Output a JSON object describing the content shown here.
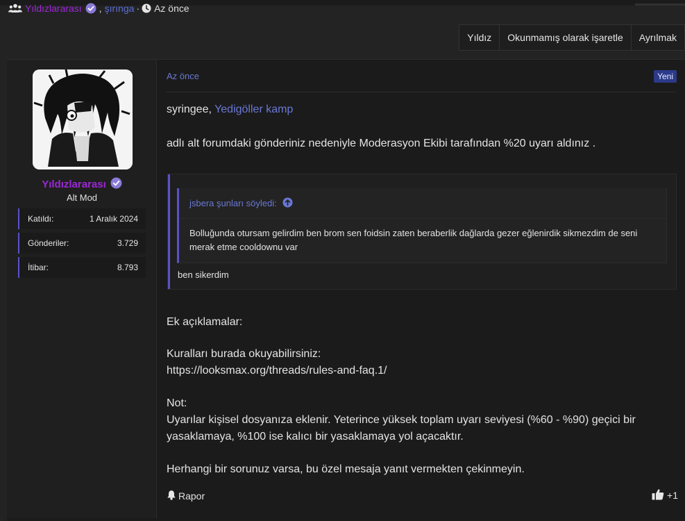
{
  "meta": {
    "participant1": "Yıldızlararası",
    "comma": ",",
    "participant2": "şırınga",
    "dot": "·",
    "time": "Az önce"
  },
  "actions": {
    "star": "Yıldız",
    "mark_unread": "Okunmamış olarak işaretle",
    "leave": "Ayrılmak"
  },
  "user": {
    "name": "Yıldızlararası",
    "title": "Alt Mod",
    "stats": [
      {
        "label": "Katıldı:",
        "value": "1 Aralık 2024"
      },
      {
        "label": "Gönderiler:",
        "value": "3.729"
      },
      {
        "label": "İtibar:",
        "value": "8.793"
      }
    ]
  },
  "post": {
    "time": "Az önce",
    "new_badge": "Yeni",
    "greeting_prefix": "syringee, ",
    "forum_link": "Yedigöller kamp",
    "warning_line": "adlı alt forumdaki gönderiniz nedeniyle Moderasyon Ekibi tarafından %20 uyarı aldınız .",
    "quote": {
      "author_line": "jsbera şunları söyledi:",
      "text": "Bolluğunda otursam gelirdim ben brom sen foidsin zaten beraberlik dağlarda gezer eğlenirdik sikmezdim de seni merak etme cooldownu var",
      "reply": "ben sikerdim"
    },
    "extra_heading": "Ek açıklamalar:",
    "rules_intro": "Kuralları burada okuyabilirsiniz:",
    "rules_link": "https://looksmax.org/threads/rules-and-faq.1/",
    "note_heading": "Not:",
    "note_line1": "Uyarılar kişisel dosyanıza eklenir. Yeterince yüksek toplam uyarı seviyesi (%60 - %90) geçici bir",
    "note_line2": "yasaklamaya, %100 ise kalıcı bir yasaklamaya yol açacaktır.",
    "closing": "Herhangi bir sorunuz varsa, bu özel mesaja yanıt vermekten çekinmeyin.",
    "report_label": "Rapor",
    "like_count": "+1"
  },
  "colors": {
    "accent": "#5b52c9",
    "username": "#9b27d6",
    "link": "#6a78d4",
    "background": "#1b1b1b"
  },
  "icons": [
    "users-icon",
    "verified-icon",
    "clock-icon",
    "arrow-up-circle-icon",
    "bell-icon",
    "thumbs-up-icon"
  ]
}
